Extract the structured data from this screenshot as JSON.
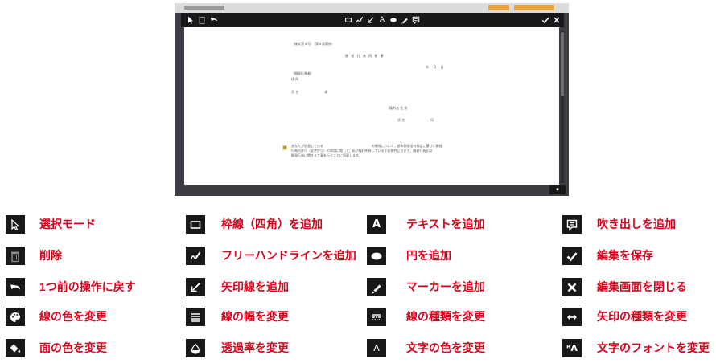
{
  "editor": {
    "toolbar": {
      "left_tools": [
        "select-mode-icon",
        "delete-icon",
        "undo-icon"
      ],
      "center_tools": [
        "rectangle-icon",
        "freehand-icon",
        "arrow-icon",
        "text-icon",
        "ellipse-icon",
        "marker-icon",
        "speech-bubble-icon"
      ],
      "text_tool_glyph": "A",
      "right_tools": [
        "check-icon",
        "close-icon"
      ]
    },
    "document": {
      "form_number": "（様式第４号）（第４条関係）",
      "title": "開 発 行 為 同 意 書",
      "date": "年 月 日",
      "recipient_label": "（開発行為者）",
      "address1": "住 所",
      "name1": "氏 名　　　　　　　　様",
      "holder_label": "権利者 住 所",
      "name2": "氏 名　　　　　　　　印",
      "body1": "あなたが計画している　　　　　　　　　　　　　　　の開発について、都市計画法の規定に基づく開発",
      "body2": "行為の許可（変更許可）の申請に際して、私が権利を有している下記物件において、開発行為又は",
      "body3": "開発行為に関する工事を行うことに同意します。",
      "highlight_mark": "抹"
    },
    "corner_button": "▾"
  },
  "legend": [
    {
      "icon": "select-mode-icon",
      "label": "選択モード"
    },
    {
      "icon": "rectangle-icon",
      "label": "枠線（四角）を追加"
    },
    {
      "icon": "text-icon",
      "glyph": "A",
      "label": "テキストを追加"
    },
    {
      "icon": "speech-bubble-icon",
      "label": "吹き出しを追加"
    },
    {
      "icon": "trash-icon",
      "label": "削除"
    },
    {
      "icon": "freehand-icon",
      "label": "フリーハンドラインを追加"
    },
    {
      "icon": "ellipse-icon",
      "label": "円を追加"
    },
    {
      "icon": "check-icon",
      "label": "編集を保存"
    },
    {
      "icon": "undo-icon",
      "label": "1つ前の操作に戻す"
    },
    {
      "icon": "arrow-icon",
      "label": "矢印線を追加"
    },
    {
      "icon": "marker-icon",
      "label": "マーカーを追加"
    },
    {
      "icon": "close-icon",
      "label": "編集画面を閉じる"
    },
    {
      "icon": "palette-icon",
      "label": "線の色を変更"
    },
    {
      "icon": "line-width-icon",
      "label": "線の幅を変更"
    },
    {
      "icon": "line-style-icon",
      "label": "線の種類を変更"
    },
    {
      "icon": "arrow-type-icon",
      "label": "矢印の種類を変更"
    },
    {
      "icon": "fill-color-icon",
      "label": "面の色を変更"
    },
    {
      "icon": "opacity-icon",
      "label": "透過率を変更"
    },
    {
      "icon": "text-color-icon",
      "glyph": "A",
      "label": "文字の色を変更"
    },
    {
      "icon": "font-icon",
      "glyph": "ᴿA",
      "label": "文字のフォントを変更"
    }
  ]
}
